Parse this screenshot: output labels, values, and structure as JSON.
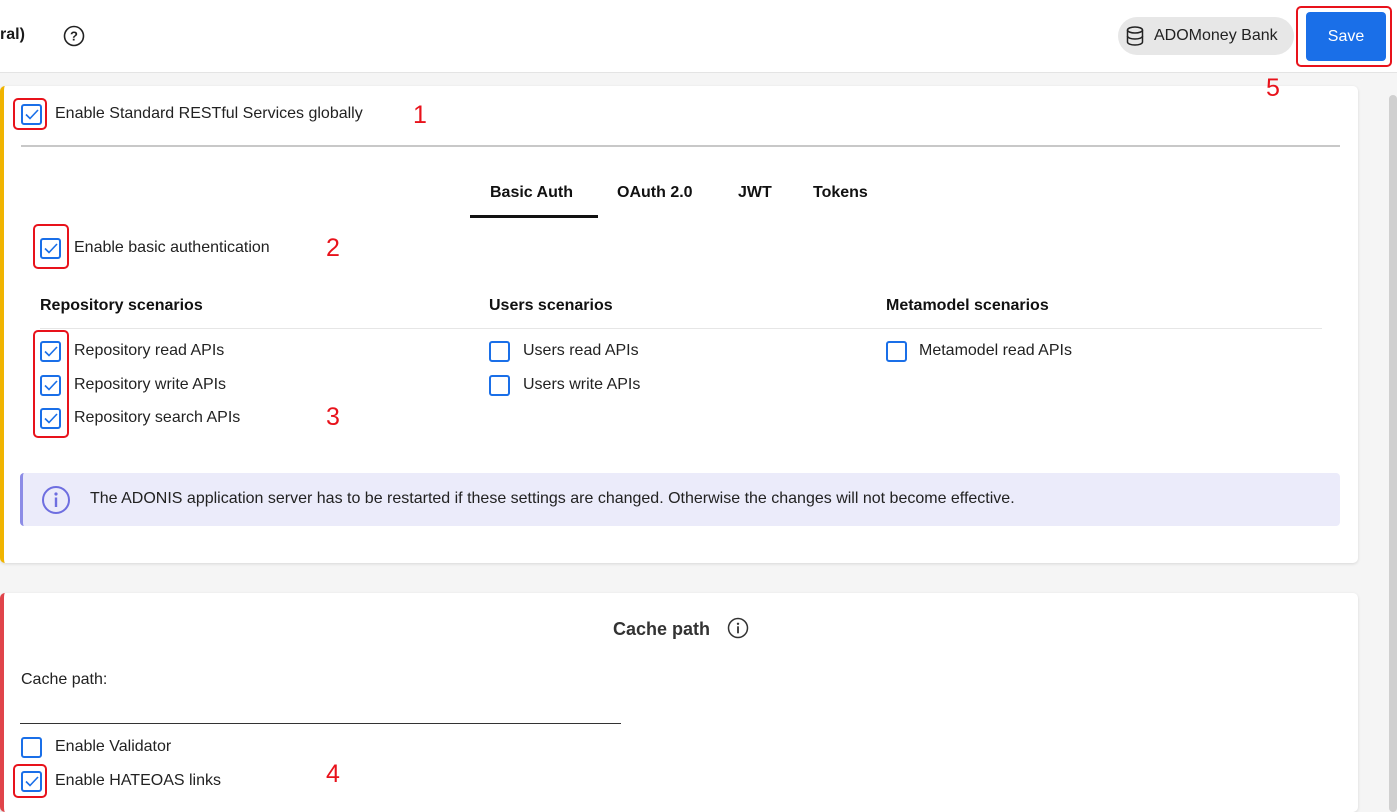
{
  "header": {
    "title": "ral)",
    "repository_name": "ADOMoney Bank",
    "save_label": "Save"
  },
  "annotations": [
    "1",
    "2",
    "3",
    "4",
    "5"
  ],
  "rest": {
    "enable_global_label": "Enable Standard RESTful Services globally",
    "enable_global_checked": true,
    "tabs": [
      "Basic Auth",
      "OAuth 2.0",
      "JWT",
      "Tokens"
    ],
    "active_tab": "Basic Auth",
    "enable_basic_label": "Enable basic authentication",
    "enable_basic_checked": true,
    "sections": {
      "repository": {
        "title": "Repository scenarios",
        "items": [
          {
            "label": "Repository read APIs",
            "checked": true
          },
          {
            "label": "Repository write APIs",
            "checked": true
          },
          {
            "label": "Repository search APIs",
            "checked": true
          }
        ]
      },
      "users": {
        "title": "Users scenarios",
        "items": [
          {
            "label": "Users read APIs",
            "checked": false
          },
          {
            "label": "Users write APIs",
            "checked": false
          }
        ]
      },
      "metamodel": {
        "title": "Metamodel scenarios",
        "items": [
          {
            "label": "Metamodel read APIs",
            "checked": false
          }
        ]
      }
    },
    "info_message": "The ADONIS application server has to be restarted if these settings are changed. Otherwise the changes will not become effective."
  },
  "cache": {
    "title": "Cache path",
    "field_label": "Cache path:",
    "field_value": "",
    "enable_validator_label": "Enable Validator",
    "enable_validator_checked": false,
    "enable_hateoas_label": "Enable HATEOAS links",
    "enable_hateoas_checked": true
  },
  "colors": {
    "accent": "#1a6fe8",
    "annotation_red": "#e8121b",
    "card1_border": "#f0b400",
    "card2_border": "#e0444a",
    "info_bg": "#ebebfa"
  }
}
